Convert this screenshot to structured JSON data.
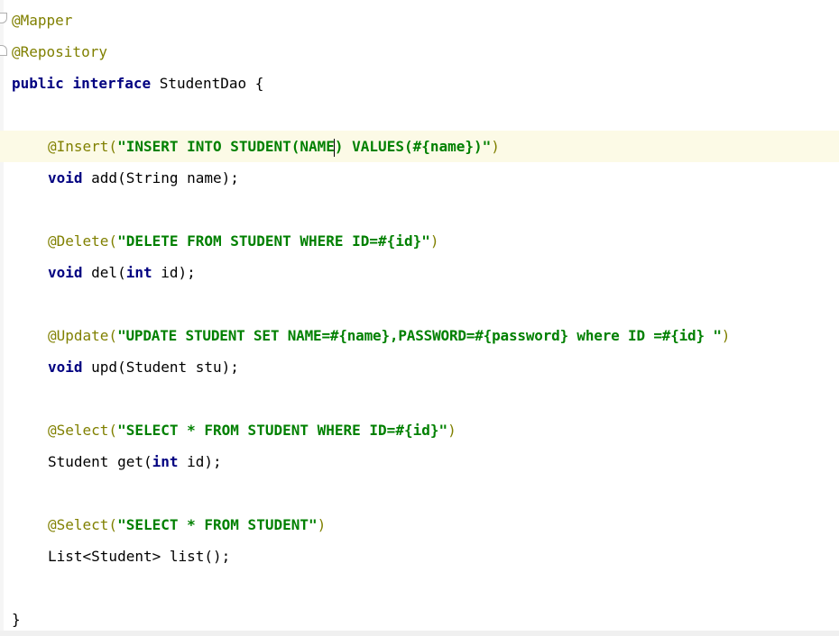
{
  "editor": {
    "file_class": "StudentDao",
    "lines": {
      "mapper": "@Mapper",
      "repository": "@Repository",
      "decl_public": "public",
      "decl_interface": "interface",
      "decl_rest": " StudentDao {",
      "insert_ann": "@Insert(",
      "insert_str_a": "\"INSERT INTO STUDENT(NAME",
      "insert_str_b": ") VALUES(#{name})\"",
      "insert_close": ")",
      "add_void": "void",
      "add_rest": " add(String name);",
      "delete_ann": "@Delete(",
      "delete_str": "\"DELETE FROM STUDENT WHERE ID=#{id}\"",
      "delete_close": ")",
      "del_void": "void",
      "del_mid": " del(",
      "del_int": "int",
      "del_rest": " id);",
      "update_ann": "@Update(",
      "update_str": "\"UPDATE STUDENT SET NAME=#{name},PASSWORD=#{password} where ID =#{id} \"",
      "update_close": ")",
      "upd_void": "void",
      "upd_rest": " upd(Student stu);",
      "select1_ann": "@Select(",
      "select1_str": "\"SELECT * FROM STUDENT WHERE ID=#{id}\"",
      "select1_close": ")",
      "get_pre": "Student get(",
      "get_int": "int",
      "get_rest": " id);",
      "select2_ann": "@Select(",
      "select2_str": "\"SELECT * FROM STUDENT\"",
      "select2_close": ")",
      "list_line": "List<Student> list();",
      "closing_brace": "}"
    },
    "colors": {
      "annotation": "#808000",
      "keyword": "#000080",
      "string": "#008000",
      "current_line": "#fcfae6"
    }
  }
}
